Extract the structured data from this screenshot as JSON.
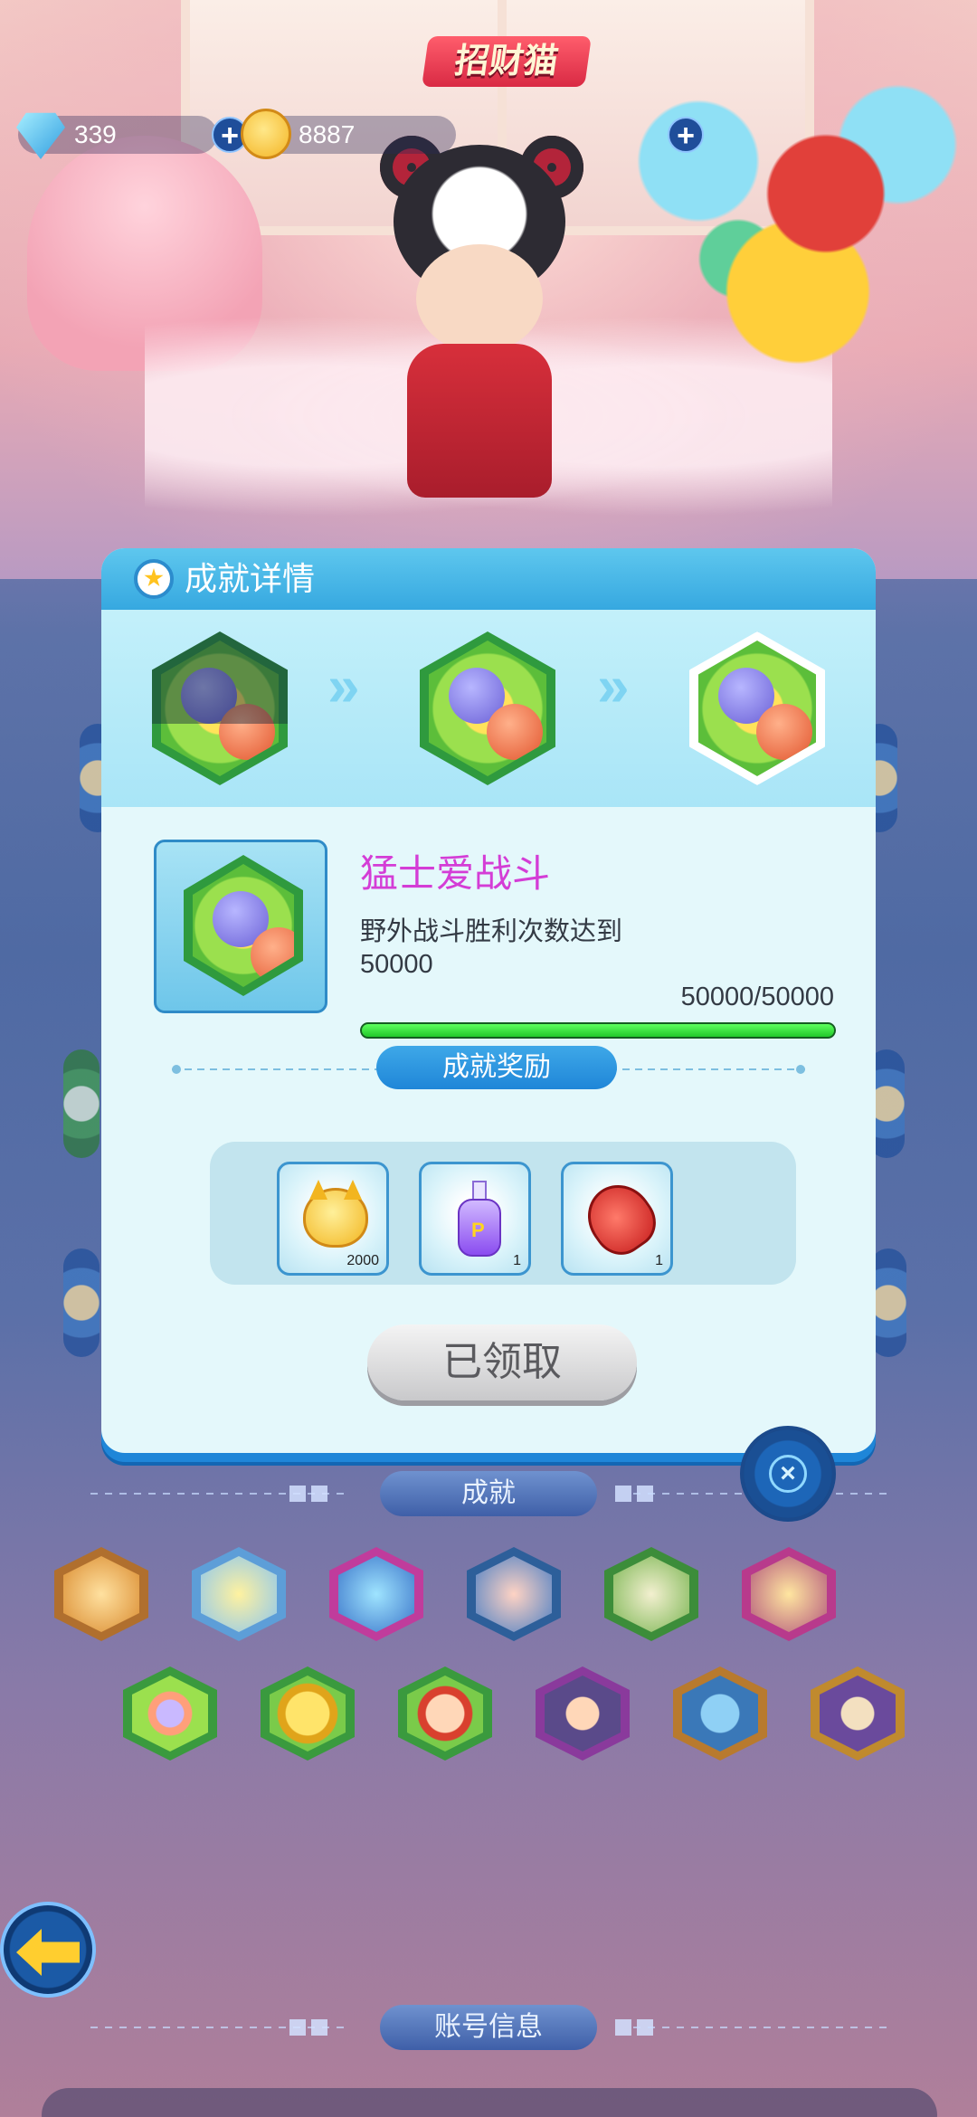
{
  "scene": {
    "title": "招财猫"
  },
  "currency": {
    "gems": "339",
    "coins": "8887",
    "gem_icon": "diamond-icon",
    "coin_icon": "cat-coin-icon",
    "plus": "+"
  },
  "background": {
    "achievements_label": "成就",
    "account_label": "账号信息",
    "badges_row1": [
      "fox-badge",
      "star-badge",
      "dice-badge",
      "chef-badge",
      "bunny-badge",
      "castle-badge"
    ],
    "badges_row2": [
      "boxing-badge",
      "coin-badge",
      "warrior-badge",
      "pirate-badge",
      "map-badge",
      "scholar-badge"
    ]
  },
  "modal": {
    "title": "成就详情",
    "stages": [
      "stage-1",
      "stage-2",
      "stage-3"
    ],
    "chevron": "»",
    "achievement_name": "猛士爱战斗",
    "description": "野外战斗胜利次数达到50000",
    "progress_text": "50000/50000",
    "progress_value": 1.0,
    "reward_label": "成就奖励",
    "rewards": [
      {
        "icon": "cat-coin-icon",
        "count": "2000"
      },
      {
        "icon": "purple-potion-icon",
        "count": "1"
      },
      {
        "icon": "red-potion-icon",
        "count": "1"
      }
    ],
    "claimed_label": "已领取",
    "close_symbol": "×"
  },
  "colors": {
    "header": "#36a8e0",
    "achievement_name": "#d43dd6",
    "progress": "#22c92a",
    "reward_pill": "#1f86d8"
  }
}
